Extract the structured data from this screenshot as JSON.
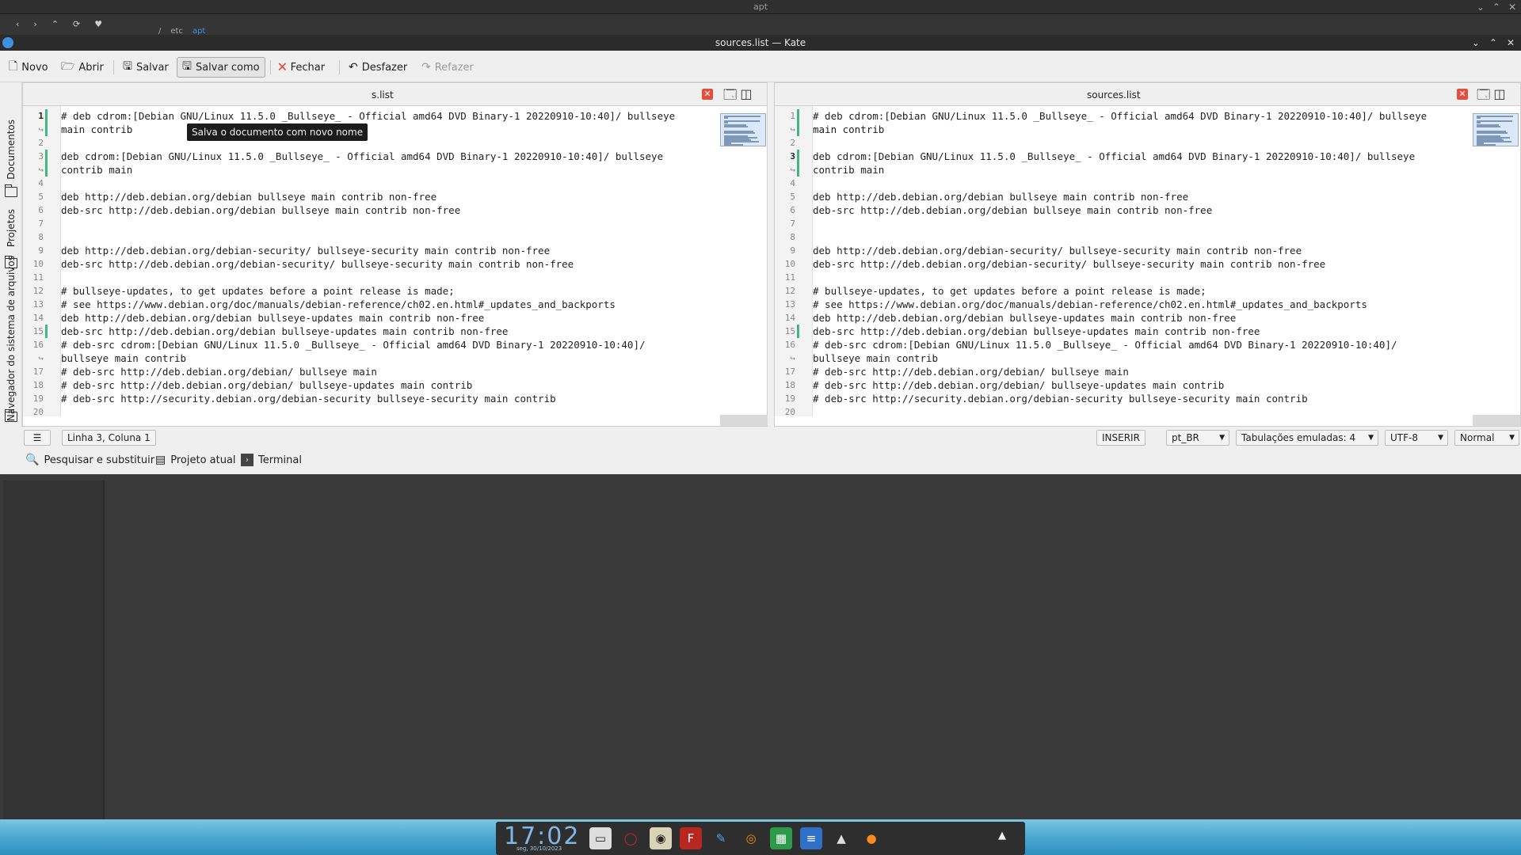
{
  "background_window": {
    "title": "apt",
    "nav_icons": [
      "back-icon",
      "forward-icon",
      "up-icon",
      "reload-icon",
      "bookmark-icon"
    ],
    "breadcrumb": [
      "/",
      "etc",
      "apt"
    ]
  },
  "window": {
    "title": "sources.list — Kate"
  },
  "toolbar": {
    "new_label": "Novo",
    "open_label": "Abrir",
    "save_label": "Salvar",
    "save_as_label": "Salvar como",
    "close_label": "Fechar",
    "undo_label": "Desfazer",
    "redo_label": "Refazer"
  },
  "tooltip": "Salva o documento com novo nome",
  "sidebar": {
    "tabs": [
      "Documentos",
      "Projetos",
      "Navegador do sistema de arquivos"
    ]
  },
  "panes": {
    "left": {
      "tab_label": "sources.list",
      "tab_label_visible": "s.list",
      "cursor_line": 1
    },
    "right": {
      "tab_label": "sources.list",
      "cursor_line": 3
    }
  },
  "lines": [
    {
      "n": "1",
      "text": "# deb cdrom:[Debian GNU/Linux 11.5.0 _Bullseye_ - Official amd64 DVD Binary-1 20220910-10:40]/ bullseye"
    },
    {
      "n": "",
      "text": "main contrib"
    },
    {
      "n": "2",
      "text": ""
    },
    {
      "n": "3",
      "text": "deb cdrom:[Debian GNU/Linux 11.5.0 _Bullseye_ - Official amd64 DVD Binary-1 20220910-10:40]/ bullseye"
    },
    {
      "n": "",
      "text": "contrib main"
    },
    {
      "n": "4",
      "text": ""
    },
    {
      "n": "5",
      "text": "deb http://deb.debian.org/debian bullseye main contrib non-free"
    },
    {
      "n": "6",
      "text": "deb-src http://deb.debian.org/debian bullseye main contrib non-free"
    },
    {
      "n": "7",
      "text": ""
    },
    {
      "n": "8",
      "text": ""
    },
    {
      "n": "9",
      "text": "deb http://deb.debian.org/debian-security/ bullseye-security main contrib non-free"
    },
    {
      "n": "10",
      "text": "deb-src http://deb.debian.org/debian-security/ bullseye-security main contrib non-free"
    },
    {
      "n": "11",
      "text": ""
    },
    {
      "n": "12",
      "text": "# bullseye-updates, to get updates before a point release is made;"
    },
    {
      "n": "13",
      "text": "# see https://www.debian.org/doc/manuals/debian-reference/ch02.en.html#_updates_and_backports"
    },
    {
      "n": "14",
      "text": "deb http://deb.debian.org/debian bullseye-updates main contrib non-free"
    },
    {
      "n": "15",
      "text": "deb-src http://deb.debian.org/debian bullseye-updates main contrib non-free"
    },
    {
      "n": "16",
      "text": "# deb-src cdrom:[Debian GNU/Linux 11.5.0 _Bullseye_ - Official amd64 DVD Binary-1 20220910-10:40]/"
    },
    {
      "n": "",
      "text": "bullseye main contrib"
    },
    {
      "n": "17",
      "text": "# deb-src http://deb.debian.org/debian/ bullseye main"
    },
    {
      "n": "18",
      "text": "# deb-src http://deb.debian.org/debian/ bullseye-updates main contrib"
    },
    {
      "n": "19",
      "text": "# deb-src http://security.debian.org/debian-security bullseye-security main contrib"
    },
    {
      "n": "20",
      "text": ""
    }
  ],
  "statusbar": {
    "position": "Linha 3, Coluna 1",
    "mode": "INSERIR",
    "language": "pt_BR",
    "indent": "Tabulações emuladas: 4",
    "encoding": "UTF-8",
    "highlight": "Normal"
  },
  "bottom_tools": {
    "search": "Pesquisar e substituir",
    "project": "Projeto atual",
    "terminal": "Terminal"
  },
  "taskbar": {
    "clock": "17:02",
    "date": "seg, 30/10/2023",
    "apps": [
      "terminal-icon",
      "opera-icon",
      "speaker-icon",
      "filezilla-icon",
      "kate-icon",
      "blender-icon",
      "spreadsheet-icon",
      "document-icon",
      "inkscape-icon",
      "firefox-icon"
    ]
  },
  "colors": {
    "accent": "#3d8fe0",
    "close_red": "#e2503d",
    "modified_green": "#41b883",
    "titlebar": "#2b2b2b"
  }
}
